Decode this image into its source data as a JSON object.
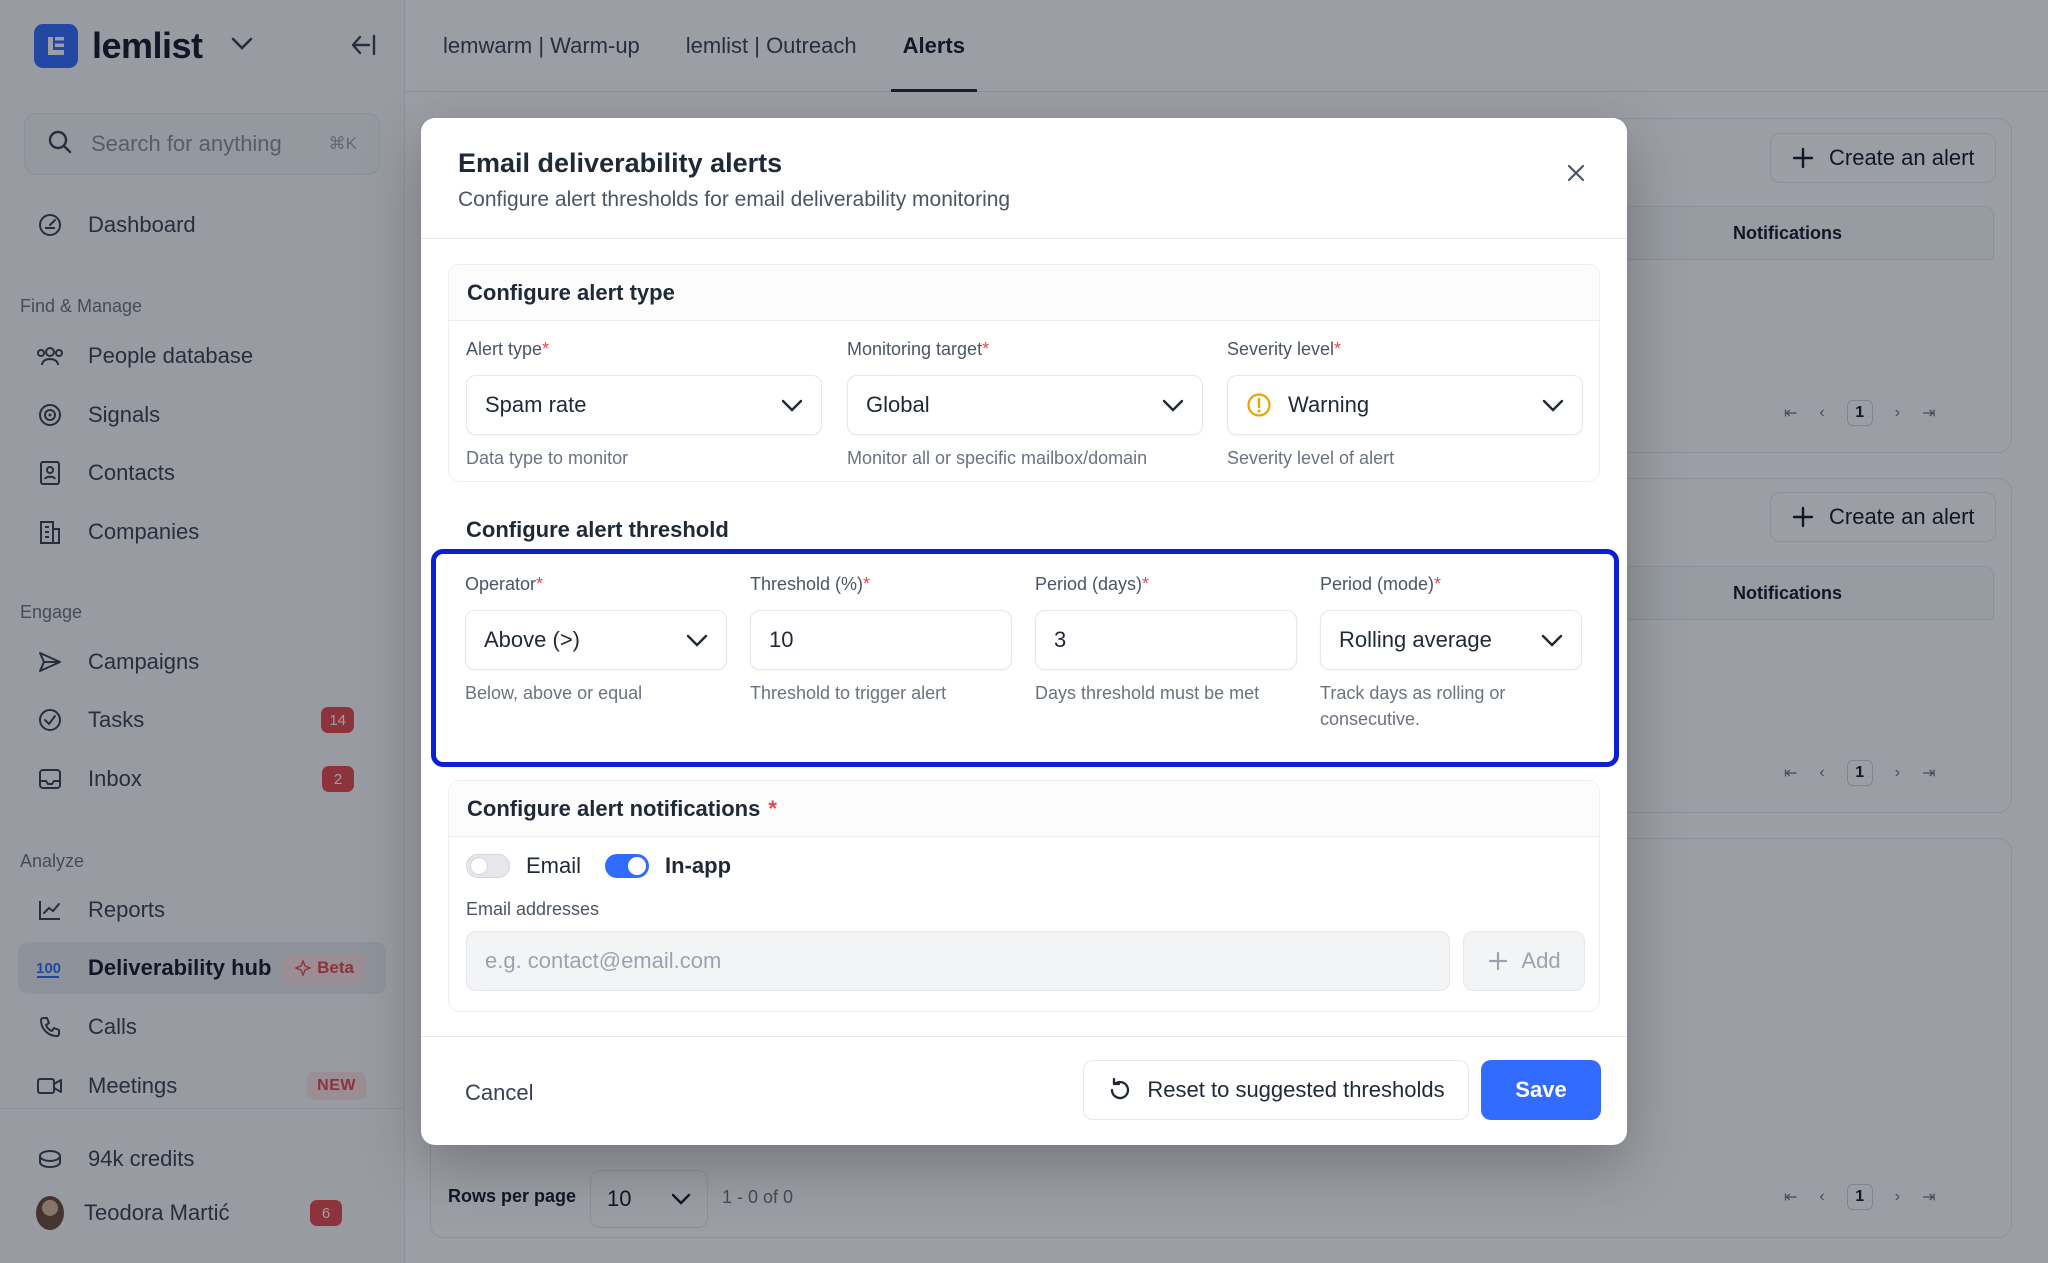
{
  "brand": {
    "name": "lemlist"
  },
  "sidebar": {
    "search_placeholder": "Search for anything",
    "search_shortcut": "⌘K",
    "dashboard": "Dashboard",
    "sections": {
      "find_manage": "Find & Manage",
      "engage": "Engage",
      "analyze": "Analyze"
    },
    "items": {
      "people_database": "People database",
      "signals": "Signals",
      "contacts": "Contacts",
      "companies": "Companies",
      "campaigns": "Campaigns",
      "tasks": "Tasks",
      "inbox": "Inbox",
      "reports": "Reports",
      "deliverability_hub": "Deliverability hub",
      "calls": "Calls",
      "meetings": "Meetings"
    },
    "badges": {
      "tasks": "14",
      "inbox": "2",
      "beta": "Beta",
      "new": "NEW",
      "user": "6"
    },
    "credits": "94k credits",
    "user_name": "Teodora Martić"
  },
  "tabs": [
    "lemwarm | Warm-up",
    "lemlist | Outreach",
    "Alerts"
  ],
  "background": {
    "create_alert": "Create an alert",
    "notifications_header": "Notifications",
    "page_number": "1",
    "rows_per_page_label": "Rows per page",
    "rows_per_page_value": "10",
    "range": "1 - 0 of 0"
  },
  "modal": {
    "title": "Email deliverability alerts",
    "subtitle": "Configure alert thresholds for email deliverability monitoring",
    "type_section": {
      "heading": "Configure alert type",
      "alert_type": {
        "label": "Alert type",
        "value": "Spam rate",
        "help": "Data type to monitor"
      },
      "monitoring_target": {
        "label": "Monitoring target",
        "value": "Global",
        "help": "Monitor all or specific mailbox/domain"
      },
      "severity": {
        "label": "Severity level",
        "value": "Warning",
        "help": "Severity level of alert"
      }
    },
    "threshold_section": {
      "heading": "Configure alert threshold",
      "operator": {
        "label": "Operator",
        "value": "Above (>)",
        "help": "Below, above or equal"
      },
      "threshold": {
        "label": "Threshold (%)",
        "value": "10",
        "help": "Threshold to trigger alert"
      },
      "period_days": {
        "label": "Period (days)",
        "value": "3",
        "help": "Days threshold must be met"
      },
      "period_mode": {
        "label": "Period (mode)",
        "value": "Rolling average",
        "help": "Track days as rolling or consecutive."
      }
    },
    "notifications_section": {
      "heading": "Configure alert notifications",
      "email_toggle_label": "Email",
      "inapp_toggle_label": "In-app",
      "email_addresses_label": "Email addresses",
      "email_placeholder": "e.g. contact@email.com",
      "add_label": "Add"
    },
    "cancel": "Cancel",
    "reset": "Reset to suggested thresholds",
    "save": "Save"
  },
  "colors": {
    "accent": "#316bff",
    "danger": "#e5484d",
    "highlight": "#0a1fd6"
  }
}
